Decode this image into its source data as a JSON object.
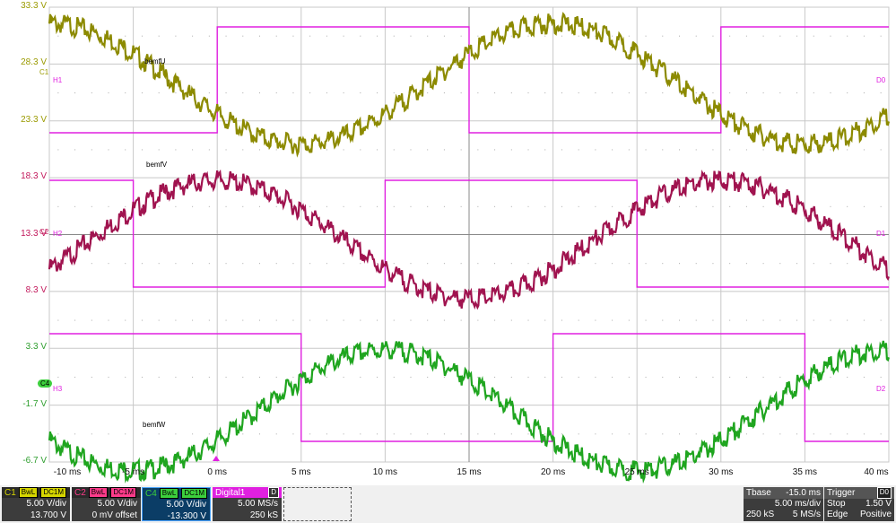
{
  "y_axis_labels": [
    {
      "text": "33.3 V",
      "color": "#9a9a00"
    },
    {
      "text": "28.3 V",
      "color": "#9a9a00"
    },
    {
      "text": "23.3 V",
      "color": "#9a9a00"
    },
    {
      "text": "18.3 V",
      "color": "#c2185b"
    },
    {
      "text": "13.3 V",
      "color": "#c2185b"
    },
    {
      "text": "8.3 V",
      "color": "#c2185b"
    },
    {
      "text": "3.3 V",
      "color": "#2e9e2e"
    },
    {
      "text": "-1.7 V",
      "color": "#2e9e2e"
    },
    {
      "text": "-6.7 V",
      "color": "#2e9e2e"
    }
  ],
  "x_axis_labels": [
    "-10 ms",
    "-5 ms",
    "0 ms",
    "5 ms",
    "10 ms",
    "15 ms",
    "20 ms",
    "25 ms",
    "30 ms",
    "35 ms",
    "40 ms"
  ],
  "channel_markers": {
    "c1": "C1",
    "c2": "C2",
    "c4": "C4",
    "h1": "H1",
    "h2": "H2",
    "h3": "H3",
    "d0": "D0",
    "d1": "D1",
    "d2": "D2"
  },
  "trace_labels": {
    "u": "bemfU",
    "v": "bemfV",
    "w": "bemfW"
  },
  "colors": {
    "c1": "#8c8a00",
    "c2": "#a0134f",
    "c4": "#1fa51f",
    "digital": "#e020e0",
    "grid": "#c8c8c8"
  },
  "bottom": {
    "c1": {
      "name": "C1",
      "bw": "BwL",
      "cpl": "DC1M",
      "vdiv": "5.00 V/div",
      "offset": "13.700 V"
    },
    "c2": {
      "name": "C2",
      "bw": "BwL",
      "cpl": "DC1M",
      "vdiv": "5.00 V/div",
      "offset": "0 mV offset"
    },
    "c4": {
      "name": "C4",
      "bw": "BwL",
      "cpl": "DC1M",
      "vdiv": "5.00 V/div",
      "offset": "-13.300 V"
    },
    "digital": {
      "name": "Digital1",
      "badge": "D",
      "rate": "5.00 MS/s",
      "samples": "250 kS"
    },
    "tbase": {
      "label": "Tbase",
      "value": "-15.0 ms",
      "tdiv": "5.00 ms/div",
      "samples": "250 kS",
      "rate": "5 MS/s"
    },
    "trigger": {
      "label": "Trigger",
      "badge": "D0",
      "mode": "Stop",
      "level": "1.50 V",
      "type": "Edge",
      "slope": "Positive"
    }
  },
  "chart_data": {
    "type": "line",
    "xlabel": "",
    "ylabel": "",
    "xlim": [
      -10,
      40
    ],
    "series": [
      {
        "name": "bemfU",
        "channel": "C1",
        "amplitude_v": 5.3,
        "center_v": 27.0,
        "period_ms": 30,
        "peak_ms": 20,
        "unit": "V"
      },
      {
        "name": "bemfV",
        "channel": "C2",
        "amplitude_v": 5.2,
        "center_v": 13.3,
        "period_ms": 30,
        "peak_ms": 0,
        "unit": "V"
      },
      {
        "name": "bemfW",
        "channel": "C4",
        "amplitude_v": 5.3,
        "center_v": -1.7,
        "period_ms": 30,
        "peak_ms": 10,
        "unit": "V"
      },
      {
        "name": "D0",
        "type": "digital",
        "high_intervals_ms": [
          [
            0,
            15
          ],
          [
            30,
            45
          ]
        ]
      },
      {
        "name": "D1",
        "type": "digital",
        "high_intervals_ms": [
          [
            -15,
            -5
          ],
          [
            10,
            25
          ]
        ]
      },
      {
        "name": "D2",
        "type": "digital",
        "high_intervals_ms": [
          [
            -10,
            5
          ],
          [
            20,
            35
          ]
        ]
      }
    ]
  }
}
